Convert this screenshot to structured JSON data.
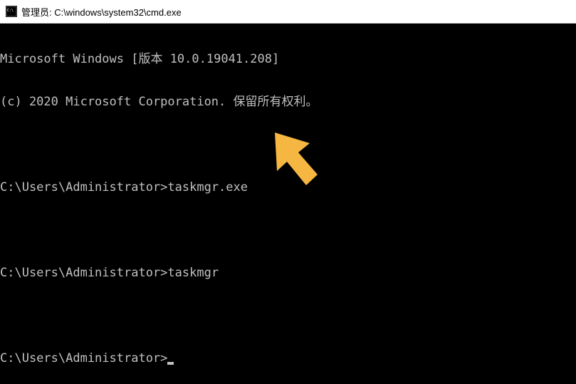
{
  "titlebar": {
    "title": "管理员: C:\\windows\\system32\\cmd.exe"
  },
  "terminal": {
    "banner_line1": "Microsoft Windows [版本 10.0.19041.208]",
    "banner_line2": "(c) 2020 Microsoft Corporation. 保留所有权利。",
    "lines": [
      {
        "prompt": "C:\\Users\\Administrator>",
        "command": "taskmgr.exe"
      },
      {
        "prompt": "C:\\Users\\Administrator>",
        "command": "taskmgr"
      },
      {
        "prompt": "C:\\Users\\Administrator>",
        "command": ""
      }
    ]
  },
  "annotation": {
    "arrow_color": "#f5b642"
  }
}
